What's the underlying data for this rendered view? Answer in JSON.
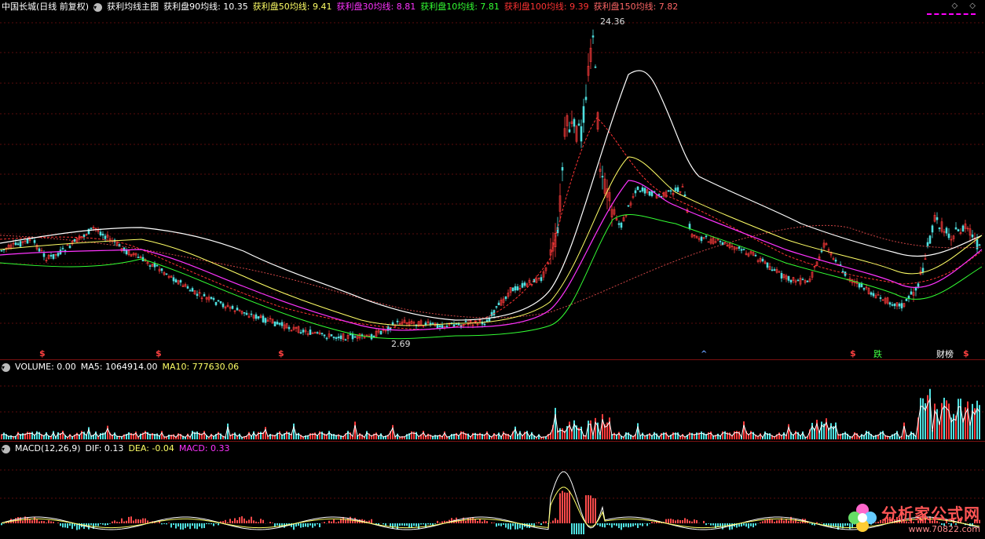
{
  "main": {
    "stock_name": "中国长城(日线 前复权)",
    "indicator_name": "获利均线主图",
    "values": [
      {
        "label": "获利盘90均线: 10.35",
        "color": "#ffffff"
      },
      {
        "label": "获利盘50均线: 9.41",
        "color": "#ffff66"
      },
      {
        "label": "获利盘30均线: 8.81",
        "color": "#ff33ff"
      },
      {
        "label": "获利盘10均线: 7.81",
        "color": "#33ff33"
      },
      {
        "label": "获利盘100均线: 9.39",
        "color": "#ff3333"
      },
      {
        "label": "获利盘150均线: 7.82",
        "color": "#ff6666"
      }
    ],
    "high_label": "24.36",
    "low_label": "2.69",
    "tools": "◇ ◇",
    "markers": [
      {
        "text": "$",
        "style": "red"
      },
      {
        "text": "$",
        "style": "red"
      },
      {
        "text": "$",
        "style": "red"
      },
      {
        "text": "^",
        "style": "blue"
      },
      {
        "text": "$",
        "style": "red"
      },
      {
        "text": "跌",
        "style": "green"
      },
      {
        "text": "财榜",
        "style": "white"
      },
      {
        "text": "$",
        "style": "red"
      }
    ]
  },
  "volume": {
    "title": "VOLUME: 0.00",
    "ma5": "MA5: 1064914.00",
    "ma10": "MA10: 777630.06",
    "ma5_color": "#ffffff",
    "ma10_color": "#ffff66"
  },
  "macd": {
    "title": "MACD(12,26,9)",
    "dif": "DIF: 0.13",
    "dea": "DEA: -0.04",
    "macd": "MACD: 0.33",
    "macd_color": "#ff33ff"
  },
  "watermark": {
    "title": "分析家公式网",
    "url": "www.70822.com"
  }
}
